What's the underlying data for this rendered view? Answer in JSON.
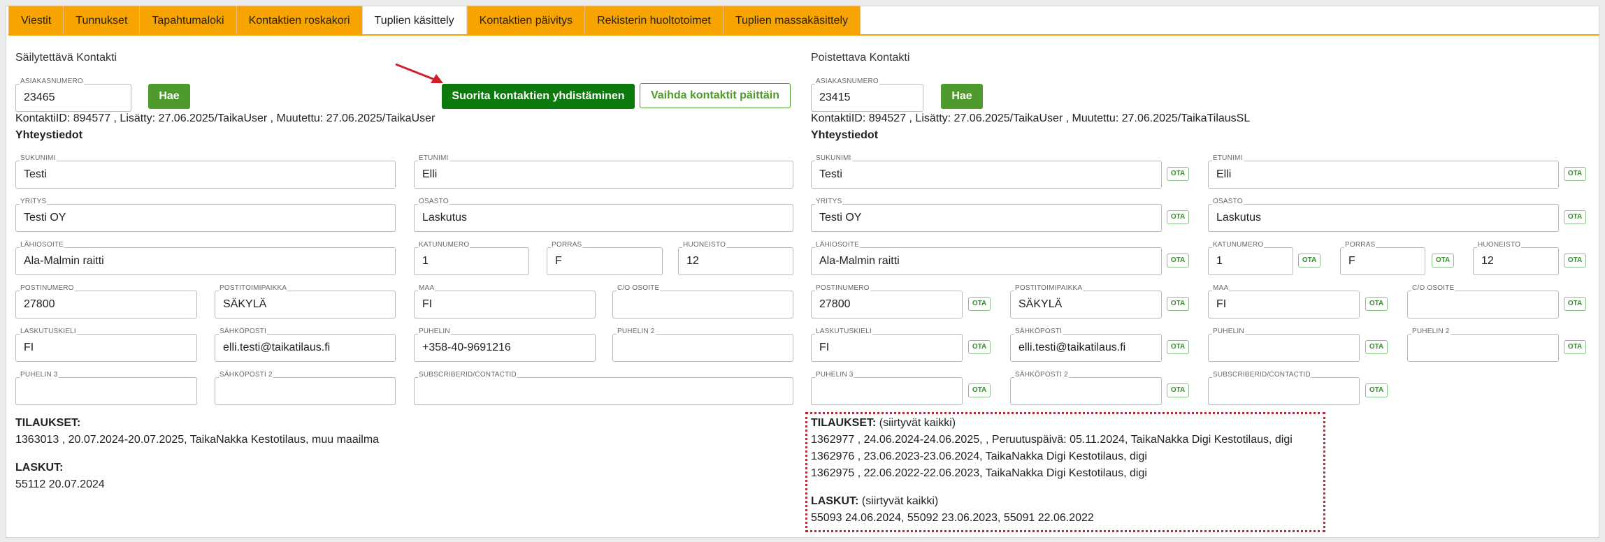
{
  "tabs": [
    {
      "label": "Viestit"
    },
    {
      "label": "Tunnukset"
    },
    {
      "label": "Tapahtumaloki"
    },
    {
      "label": "Kontaktien roskakori"
    },
    {
      "label": "Tuplien käsittely"
    },
    {
      "label": "Kontaktien päivitys"
    },
    {
      "label": "Rekisterin huoltotoimet"
    },
    {
      "label": "Tuplien massakäsittely"
    }
  ],
  "actions": {
    "merge_label": "Suorita kontaktien yhdistäminen",
    "swap_label": "Vaihda kontaktit päittäin"
  },
  "left": {
    "title": "Säilytettävä Kontakti",
    "customer_label": "ASIAKASNUMERO",
    "customer_value": "23465",
    "fetch_label": "Hae",
    "meta": "KontaktiID: 894577 , Lisätty: 27.06.2025/TaikaUser , Muutettu: 27.06.2025/TaikaUser",
    "contact_heading": "Yhteystiedot",
    "fields": {
      "sukunimi": {
        "label": "Sukunimi",
        "value": "Testi"
      },
      "etunimi": {
        "label": "Etunimi",
        "value": "Elli"
      },
      "yritys": {
        "label": "Yritys",
        "value": "Testi OY"
      },
      "osasto": {
        "label": "Osasto",
        "value": "Laskutus"
      },
      "lahiosoite": {
        "label": "Lähiosoite",
        "value": "Ala-Malmin raitti"
      },
      "katunumero": {
        "label": "Katunumero",
        "value": "1"
      },
      "porras": {
        "label": "Porras",
        "value": "F"
      },
      "huoneisto": {
        "label": "Huoneisto",
        "value": "12"
      },
      "postinumero": {
        "label": "Postinumero",
        "value": "27800"
      },
      "postitoimipaikka": {
        "label": "Postitoimipaikka",
        "value": "SÄKYLÄ"
      },
      "maa": {
        "label": "Maa",
        "value": "FI"
      },
      "co_osoite": {
        "label": "C/O Osoite",
        "value": ""
      },
      "laskutuskieli": {
        "label": "Laskutuskieli",
        "value": "FI"
      },
      "sahkoposti": {
        "label": "Sähköposti",
        "value": "elli.testi@taikatilaus.fi"
      },
      "puhelin": {
        "label": "Puhelin",
        "value": "+358-40-9691216"
      },
      "puhelin2": {
        "label": "Puhelin 2",
        "value": ""
      },
      "puhelin3": {
        "label": "Puhelin 3",
        "value": ""
      },
      "sahkoposti2": {
        "label": "Sähköposti 2",
        "value": ""
      },
      "subscriberid": {
        "label": "SubscriberID/ContactID",
        "value": ""
      }
    },
    "orders_heading": "TILAUKSET:",
    "orders": [
      "1363013 , 20.07.2024-20.07.2025, TaikaNakka Kestotilaus, muu maailma"
    ],
    "invoices_heading": "LASKUT:",
    "invoices": "55112 20.07.2024"
  },
  "right": {
    "title": "Poistettava Kontakti",
    "customer_label": "ASIAKASNUMERO",
    "customer_value": "23415",
    "fetch_label": "Hae",
    "meta": "KontaktiID: 894527 , Lisätty: 27.06.2025/TaikaUser , Muutettu: 27.06.2025/TaikaTilausSL",
    "contact_heading": "Yhteystiedot",
    "take_label": "OTA",
    "fields": {
      "sukunimi": {
        "label": "Sukunimi",
        "value": "Testi"
      },
      "etunimi": {
        "label": "Etunimi",
        "value": "Elli"
      },
      "yritys": {
        "label": "Yritys",
        "value": "Testi OY"
      },
      "osasto": {
        "label": "Osasto",
        "value": "Laskutus"
      },
      "lahiosoite": {
        "label": "Lähiosoite",
        "value": "Ala-Malmin raitti"
      },
      "katunumero": {
        "label": "Katunumero",
        "value": "1"
      },
      "porras": {
        "label": "Porras",
        "value": "F"
      },
      "huoneisto": {
        "label": "Huoneisto",
        "value": "12"
      },
      "postinumero": {
        "label": "Postinumero",
        "value": "27800"
      },
      "postitoimipaikka": {
        "label": "Postitoimipaikka",
        "value": "SÄKYLÄ"
      },
      "maa": {
        "label": "Maa",
        "value": "FI"
      },
      "co_osoite": {
        "label": "C/O Osoite",
        "value": ""
      },
      "laskutuskieli": {
        "label": "Laskutuskieli",
        "value": "FI"
      },
      "sahkoposti": {
        "label": "Sähköposti",
        "value": "elli.testi@taikatilaus.fi"
      },
      "puhelin": {
        "label": "Puhelin",
        "value": ""
      },
      "puhelin2": {
        "label": "Puhelin 2",
        "value": ""
      },
      "puhelin3": {
        "label": "Puhelin 3",
        "value": ""
      },
      "sahkoposti2": {
        "label": "Sähköposti 2",
        "value": ""
      },
      "subscriberid": {
        "label": "SubscriberID/ContactID",
        "value": ""
      }
    },
    "orders_heading": "TILAUKSET:",
    "orders_note": "(siirtyvät kaikki)",
    "orders": [
      "1362977 , 24.06.2024-24.06.2025, , Peruutuspäivä: 05.11.2024, TaikaNakka Digi Kestotilaus, digi",
      "1362976 , 23.06.2023-23.06.2024, TaikaNakka Digi Kestotilaus, digi",
      "1362975 , 22.06.2022-22.06.2023, TaikaNakka Digi Kestotilaus, digi"
    ],
    "invoices_heading": "LASKUT:",
    "invoices_note": "(siirtyvät kaikki)",
    "invoices": "55093 24.06.2024, 55092 23.06.2023, 55091 22.06.2022"
  },
  "colors": {
    "tab_orange": "#f7a400",
    "button_green": "#4f9a2c",
    "merge_green": "#0c7a0c",
    "highlight_red": "#d0202c",
    "arrow_red": "#d0202c"
  }
}
